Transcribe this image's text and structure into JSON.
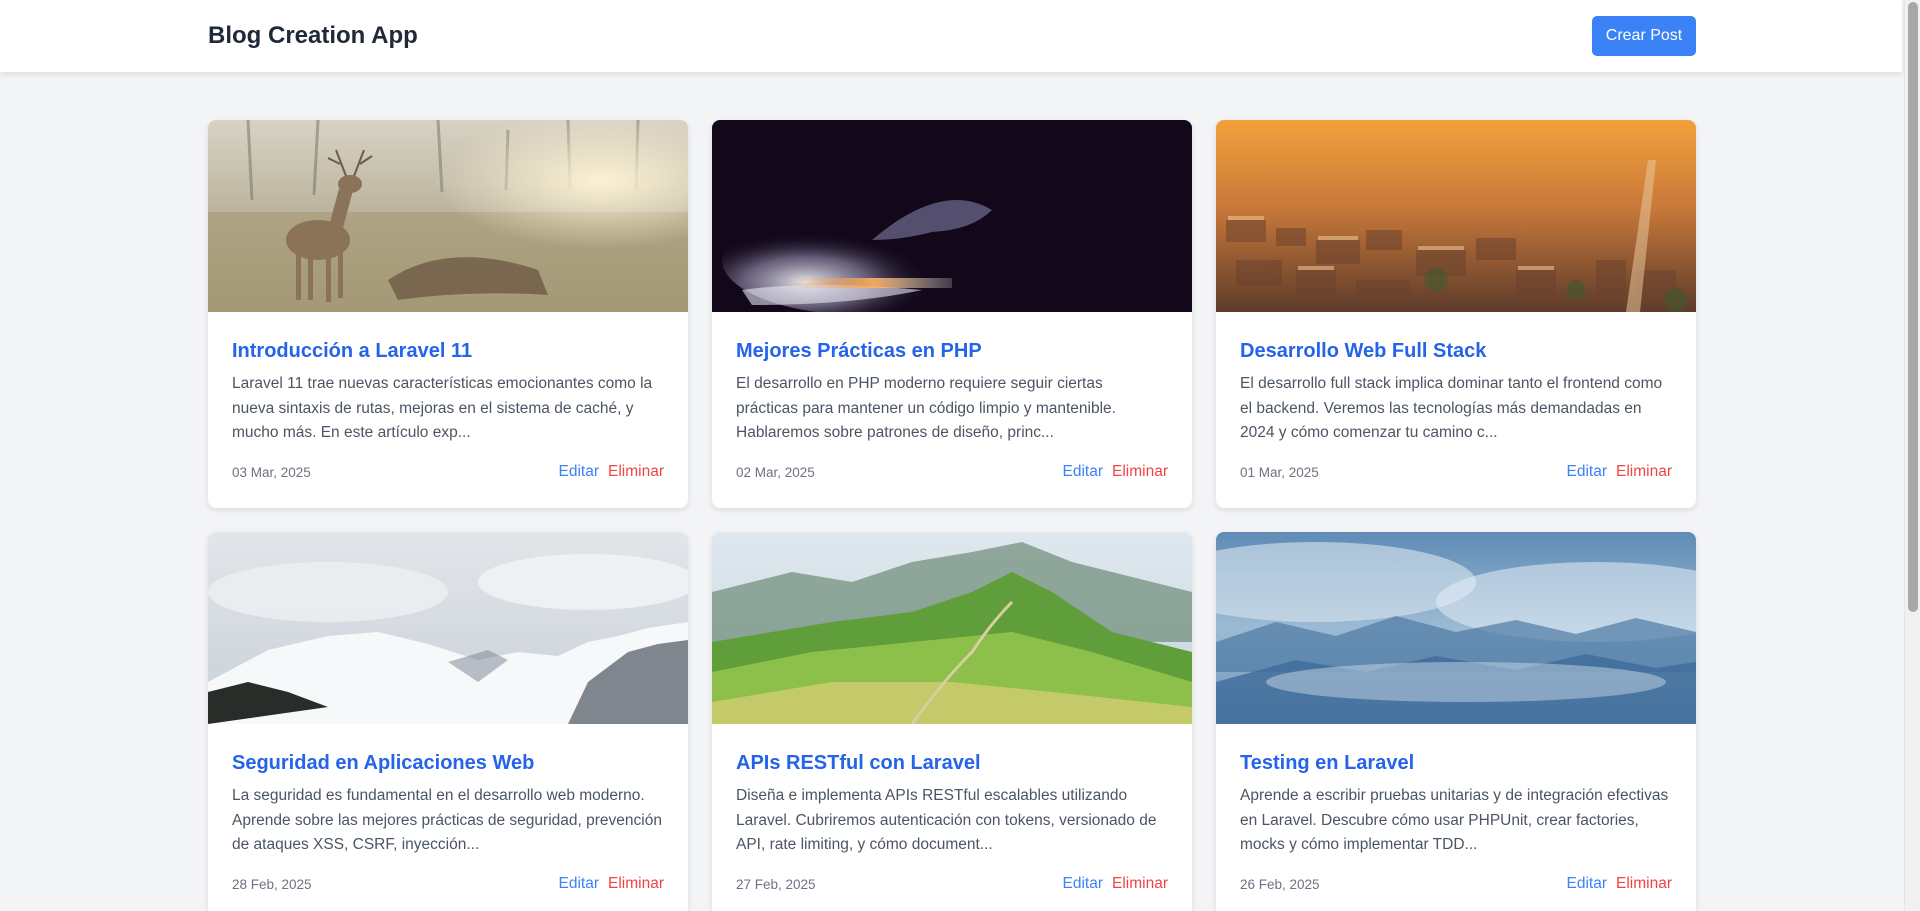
{
  "app": {
    "title": "Blog Creation App",
    "create_label": "Crear Post"
  },
  "colors": {
    "accent": "#3b82f6",
    "title": "#2563eb",
    "danger": "#ef4444",
    "background": "#f3f4f6"
  },
  "posts": [
    {
      "title": "Introducción a Laravel 11",
      "excerpt": "Laravel 11 trae nuevas características emocionantes como la nueva sintaxis de rutas, mejoras en el sistema de caché, y mucho más. En este artículo exp...",
      "date": "03 Mar, 2025",
      "image": "deer-in-field-photo",
      "edit_label": "Editar",
      "delete_label": "Eliminar"
    },
    {
      "title": "Mejores Prácticas en PHP",
      "excerpt": "El desarrollo en PHP moderno requiere seguir ciertas prácticas para mantener un código limpio y mantenible. Hablaremos sobre patrones de diseño, princ...",
      "date": "02 Mar, 2025",
      "image": "smoke-in-dark-photo",
      "edit_label": "Editar",
      "delete_label": "Eliminar"
    },
    {
      "title": "Desarrollo Web Full Stack",
      "excerpt": "El desarrollo full stack implica dominar tanto el frontend como el backend. Veremos las tecnologías más demandadas en 2024 y cómo comenzar tu camino c...",
      "date": "01 Mar, 2025",
      "image": "city-sunset-photo",
      "edit_label": "Editar",
      "delete_label": "Eliminar"
    },
    {
      "title": "Seguridad en Aplicaciones Web",
      "excerpt": "La seguridad es fundamental en el desarrollo web moderno. Aprende sobre las mejores prácticas de seguridad, prevención de ataques XSS, CSRF, inyección...",
      "date": "28 Feb, 2025",
      "image": "snowy-mountains-photo",
      "edit_label": "Editar",
      "delete_label": "Eliminar"
    },
    {
      "title": "APIs RESTful con Laravel",
      "excerpt": "Diseña e implementa APIs RESTful escalables utilizando Laravel. Cubriremos autenticación con tokens, versionado de API, rate limiting, y cómo document...",
      "date": "27 Feb, 2025",
      "image": "green-hills-photo",
      "edit_label": "Editar",
      "delete_label": "Eliminar"
    },
    {
      "title": "Testing en Laravel",
      "excerpt": "Aprende a escribir pruebas unitarias y de integración efectivas en Laravel. Descubre cómo usar PHPUnit, crear factories, mocks y cómo implementar TDD...",
      "date": "26 Feb, 2025",
      "image": "misty-blue-mountains-photo",
      "edit_label": "Editar",
      "delete_label": "Eliminar"
    }
  ]
}
